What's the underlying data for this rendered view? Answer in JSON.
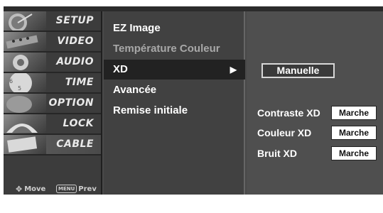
{
  "categories": [
    {
      "label": "SETUP"
    },
    {
      "label": "VIDEO"
    },
    {
      "label": "AUDIO"
    },
    {
      "label": "TIME"
    },
    {
      "label": "OPTION"
    },
    {
      "label": "LOCK"
    },
    {
      "label": "CABLE"
    }
  ],
  "hints": {
    "move_label": "Move",
    "menu_key": "MENU",
    "prev_label": "Prev"
  },
  "menu": {
    "items": [
      {
        "label": "EZ Image"
      },
      {
        "label": "Température Couleur"
      },
      {
        "label": "XD"
      },
      {
        "label": "Avancée"
      },
      {
        "label": "Remise initiale"
      }
    ],
    "selected_arrow": "▶"
  },
  "submenu": {
    "mode_value": "Manuelle",
    "params": [
      {
        "label": "Contraste XD",
        "value": "Marche"
      },
      {
        "label": "Couleur XD",
        "value": "Marche"
      },
      {
        "label": "Bruit XD",
        "value": "Marche"
      }
    ]
  },
  "colors": {
    "panel_dark": "#3c3c3c",
    "menu_bg": "#414141",
    "submenu_bg": "#4f4f4f",
    "selected_row": "#222222",
    "text": "#ffffff",
    "dim_text": "#a8a8a8"
  },
  "icons": {
    "move": "four-way-arrows-icon"
  }
}
